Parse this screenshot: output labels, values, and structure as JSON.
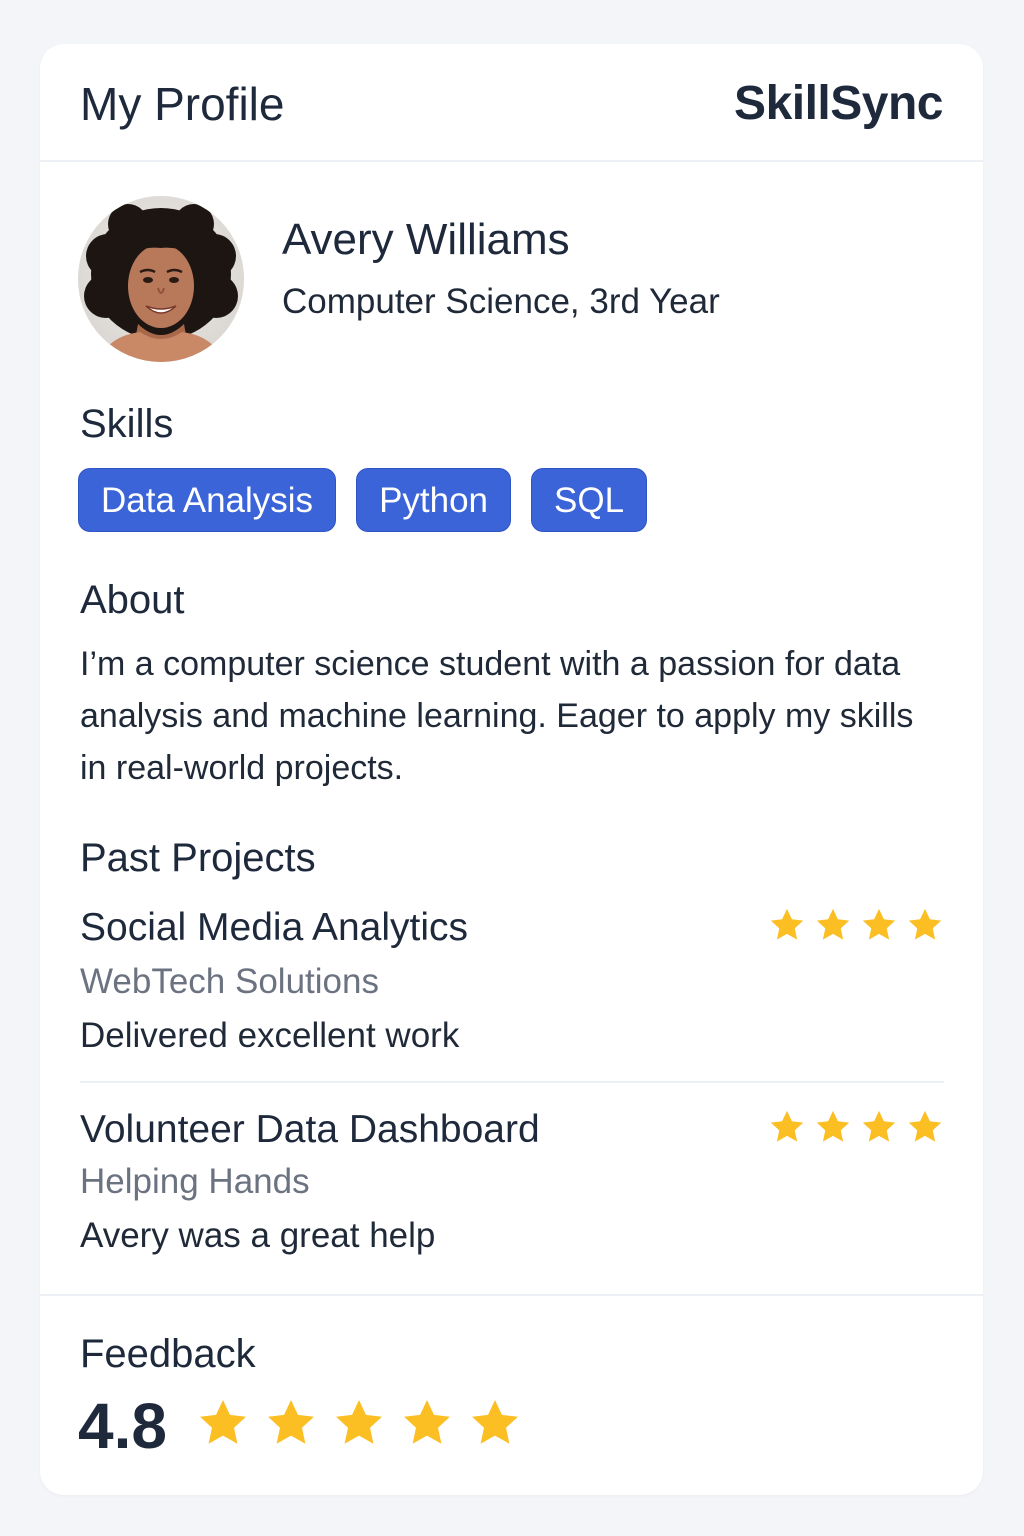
{
  "header": {
    "title": "My Profile",
    "brand": "SkillSync"
  },
  "profile": {
    "name": "Avery Williams",
    "program": "Computer Science,  3rd Year",
    "avatar_icon": "profile-photo"
  },
  "skills": {
    "heading": "Skills",
    "items": [
      "Data Analysis",
      "Python",
      "SQL"
    ]
  },
  "about": {
    "heading": "About",
    "text": "I’m a computer science student with a passion for data analysis and machine learning. Eager to apply my skills in real-world projects."
  },
  "projects": {
    "heading": "Past Projects",
    "items": [
      {
        "title": "Social Media Analytics",
        "client": "WebTech Solutions",
        "note": "Delivered excellent work",
        "stars": 4
      },
      {
        "title": "Volunteer Data Dashboard",
        "client": "Helping Hands",
        "note": "Avery was a great help",
        "stars": 4
      }
    ]
  },
  "feedback": {
    "heading": "Feedback",
    "rating": "4.8",
    "stars": 5
  },
  "colors": {
    "accent": "#3b64d8",
    "star": "#fbbf24",
    "muted_text": "#6b7280",
    "heading_text": "#1e293b"
  }
}
